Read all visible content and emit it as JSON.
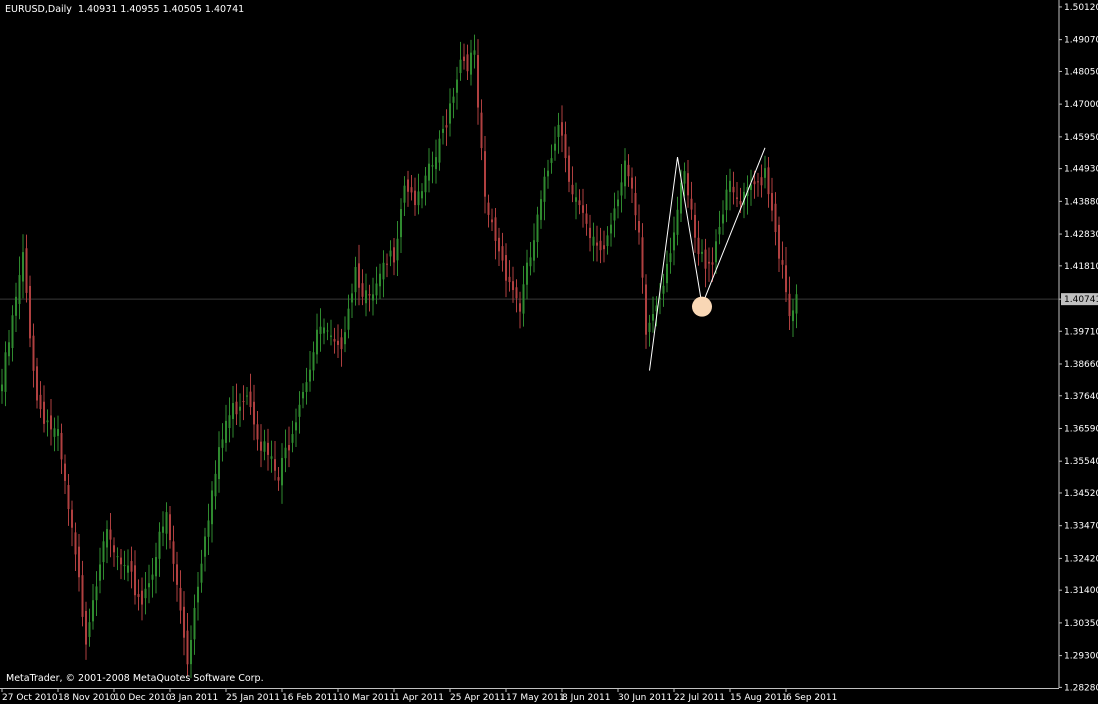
{
  "header": {
    "symbol": "EURUSD,Daily",
    "ohlc": "1.40931 1.40955 1.40505 1.40741"
  },
  "copyright": "MetaTrader, © 2001-2008 MetaQuotes Software Corp.",
  "colors": {
    "background": "#000000",
    "axis": "#c0c0c0",
    "bull": "#2f8a2f",
    "bear": "#b04040",
    "price_line": "#3a3a3a",
    "price_label_bg": "#c0c0c0",
    "trend_line": "#ffffff",
    "marker": "#f9d7b5"
  },
  "chart_data": {
    "type": "candlestick",
    "symbol": "EURUSD",
    "timeframe": "Daily",
    "ylim": [
      1.2826,
      1.5015
    ],
    "y_ticks": [
      "1.50120",
      "1.49070",
      "1.48050",
      "1.47000",
      "1.45950",
      "1.44930",
      "1.43880",
      "1.42830",
      "1.41810",
      "1.40741",
      "1.39710",
      "1.38660",
      "1.37640",
      "1.36590",
      "1.35540",
      "1.34520",
      "1.33470",
      "1.32420",
      "1.31400",
      "1.30350",
      "1.29300",
      "1.28280"
    ],
    "current_price": "1.40741",
    "x_labels": [
      "27 Oct 2010",
      "18 Nov 2010",
      "10 Dec 2010",
      "3 Jan 2011",
      "25 Jan 2011",
      "16 Feb 2011",
      "10 Mar 2011",
      "1 Apr 2011",
      "25 Apr 2011",
      "17 May 2011",
      "8 Jun 2011",
      "30 Jun 2011",
      "22 Jul 2011",
      "15 Aug 2011",
      "6 Sep 2011"
    ],
    "anchors": [
      {
        "date": "27 Oct 2010",
        "close": 1.38
      },
      {
        "date": "4 Nov 2010",
        "close": 1.42
      },
      {
        "date": "10 Nov 2010",
        "close": 1.375
      },
      {
        "date": "18 Nov 2010",
        "close": 1.362
      },
      {
        "date": "30 Nov 2010",
        "close": 1.3
      },
      {
        "date": "7 Dec 2010",
        "close": 1.332
      },
      {
        "date": "10 Dec 2010",
        "close": 1.325
      },
      {
        "date": "22 Dec 2010",
        "close": 1.311
      },
      {
        "date": "31 Dec 2010",
        "close": 1.337
      },
      {
        "date": "10 Jan 2011",
        "close": 1.292
      },
      {
        "date": "17 Jan 2011",
        "close": 1.334
      },
      {
        "date": "25 Jan 2011",
        "close": 1.368
      },
      {
        "date": "2 Feb 2011",
        "close": 1.379
      },
      {
        "date": "8 Feb 2011",
        "close": 1.362
      },
      {
        "date": "15 Feb 2011",
        "close": 1.349
      },
      {
        "date": "23 Feb 2011",
        "close": 1.376
      },
      {
        "date": "3 Mar 2011",
        "close": 1.398
      },
      {
        "date": "10 Mar 2011",
        "close": 1.389
      },
      {
        "date": "17 Mar 2011",
        "close": 1.418
      },
      {
        "date": "23 Mar 2011",
        "close": 1.405
      },
      {
        "date": "1 Apr 2011",
        "close": 1.423
      },
      {
        "date": "6 Apr 2011",
        "close": 1.446
      },
      {
        "date": "12 Apr 2011",
        "close": 1.438
      },
      {
        "date": "20 Apr 2011",
        "close": 1.456
      },
      {
        "date": "28 Apr 2011",
        "close": 1.485
      },
      {
        "date": "4 May 2011",
        "close": 1.484
      },
      {
        "date": "9 May 2011",
        "close": 1.437
      },
      {
        "date": "17 May 2011",
        "close": 1.417
      },
      {
        "date": "23 May 2011",
        "close": 1.405
      },
      {
        "date": "27 May 2011",
        "close": 1.426
      },
      {
        "date": "7 Jun 2011",
        "close": 1.466
      },
      {
        "date": "13 Jun 2011",
        "close": 1.443
      },
      {
        "date": "20 Jun 2011",
        "close": 1.425
      },
      {
        "date": "24 Jun 2011",
        "close": 1.424
      },
      {
        "date": "4 Jul 2011",
        "close": 1.452
      },
      {
        "date": "8 Jul 2011",
        "close": 1.426
      },
      {
        "date": "12 Jul 2011",
        "close": 1.396
      },
      {
        "date": "18 Jul 2011",
        "close": 1.41
      },
      {
        "date": "27 Jul 2011",
        "close": 1.446
      },
      {
        "date": "2 Aug 2011",
        "close": 1.42
      },
      {
        "date": "8 Aug 2011",
        "close": 1.421
      },
      {
        "date": "12 Aug 2011",
        "close": 1.443
      },
      {
        "date": "18 Aug 2011",
        "close": 1.437
      },
      {
        "date": "25 Aug 2011",
        "close": 1.445
      },
      {
        "date": "29 Aug 2011",
        "close": 1.45
      },
      {
        "date": "1 Sep 2011",
        "close": 1.431
      },
      {
        "date": "7 Sep 2011",
        "close": 1.4
      },
      {
        "date": "9 Sep 2011",
        "close": 1.407
      }
    ],
    "trend_line": [
      {
        "date": "13 Jul 2011",
        "price": 1.3845
      },
      {
        "date": "25 Jul 2011",
        "price": 1.453
      },
      {
        "date": "3 Aug 2011",
        "price": 1.4055
      },
      {
        "date": "29 Aug 2011",
        "price": 1.456
      }
    ],
    "marker": {
      "date": "3 Aug 2011",
      "price": 1.405
    }
  }
}
